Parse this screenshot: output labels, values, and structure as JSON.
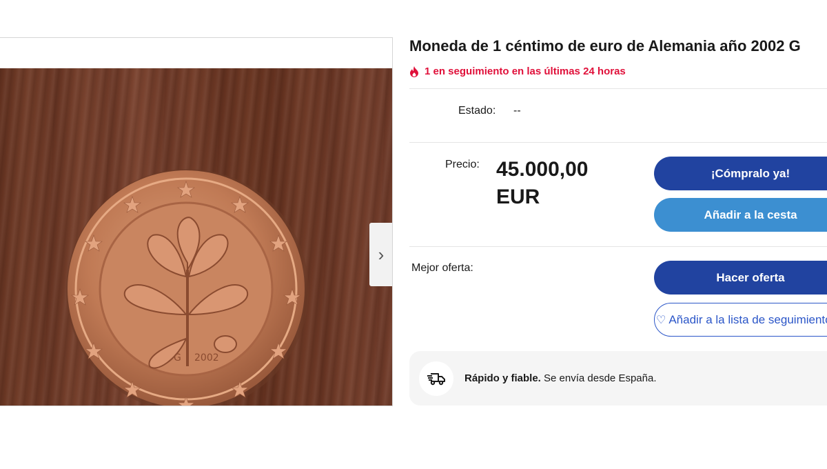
{
  "listing": {
    "title": "Moneda de 1 céntimo de euro de Alemania año 2002 G",
    "watchers": "1 en seguimiento en las últimas 24 horas",
    "condition_label": "Estado:",
    "condition_value": "--",
    "price_label": "Precio:",
    "price_amount": "45.000,00",
    "price_currency": "EUR",
    "best_offer_label": "Mejor oferta:"
  },
  "buttons": {
    "buy_now": "¡Cómpralo ya!",
    "add_to_cart": "Añadir a la cesta",
    "make_offer": "Hacer oferta",
    "watchlist": "Añadir a la lista de seguimiento"
  },
  "shipping": {
    "bold": "Rápido y fiable.",
    "text": "Se envía desde España."
  },
  "coin": {
    "mint_mark": "G",
    "year": "2002"
  },
  "icons": {
    "watchers": "flame-icon",
    "next": "chevron-right-icon",
    "watchlist": "heart-outline-icon",
    "shipping": "delivery-truck-icon"
  },
  "colors": {
    "primary_button": "#2143a0",
    "secondary_button": "#3c8fd1",
    "watchers_red": "#e0103a",
    "link_blue": "#2b56c8"
  }
}
